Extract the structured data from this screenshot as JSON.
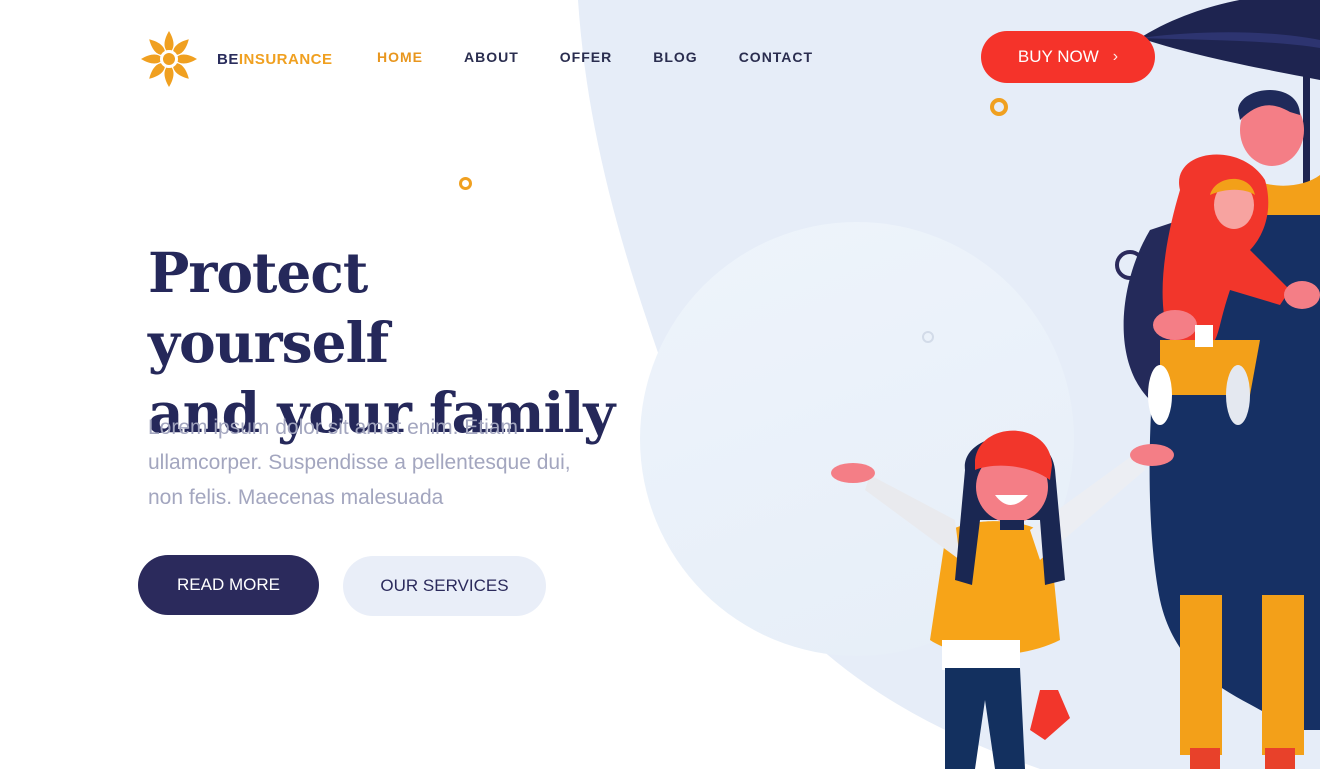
{
  "brand": {
    "part1": "BE",
    "part2": "INSURANCE"
  },
  "nav": [
    {
      "label": "HOME",
      "active": true
    },
    {
      "label": "ABOUT",
      "active": false
    },
    {
      "label": "OFFER",
      "active": false
    },
    {
      "label": "BLOG",
      "active": false
    },
    {
      "label": "CONTACT",
      "active": false
    }
  ],
  "header": {
    "cta_label": "BUY NOW",
    "cta_icon": "chevron-right-icon"
  },
  "hero": {
    "title_line1": "Protect yourself",
    "title_line2": "and your family",
    "text": "Lorem ipsum dolor sit amet enim. Etiam ullamcorper. Suspendisse a pellentesque dui, non felis. Maecenas malesuada",
    "primary_button": "READ MORE",
    "secondary_button": "OUR SERVICES"
  },
  "colors": {
    "accent_orange": "#f0a020",
    "navy": "#25285a",
    "cta_red": "#f5332a",
    "light_blue": "#e9eef8"
  },
  "illustration": "family-under-umbrella-illustration"
}
